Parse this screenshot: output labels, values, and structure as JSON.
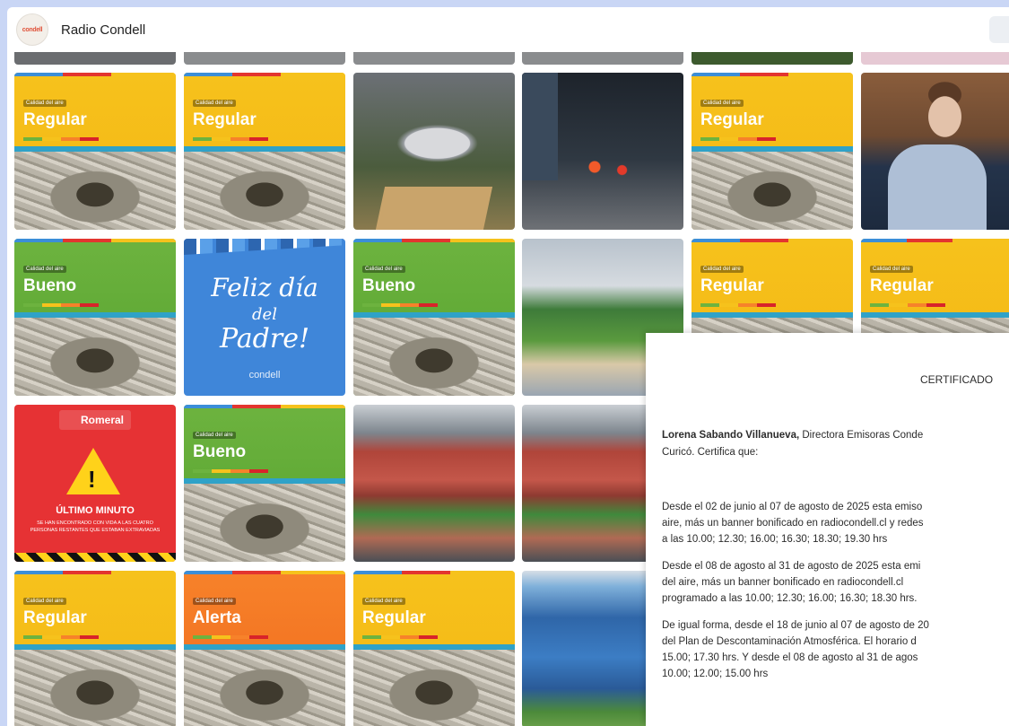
{
  "header": {
    "logo_text": "condell",
    "title": "Radio Condell"
  },
  "gallery": {
    "air_quality_label": "Calidad del aire",
    "levels": {
      "regular": "Regular",
      "bueno": "Bueno",
      "alerta": "Alerta"
    },
    "father_day": {
      "line1": "Feliz día",
      "line2": "del",
      "line3": "Padre!",
      "brand": "condell"
    },
    "alert_post": {
      "brand": "Romeral",
      "title": "ÚLTIMO MINUTO",
      "text": "SE HAN ENCONTRADO CON VIDA A LAS CUATRO PERSONAS RESTANTES QUE ESTABAN EXTRAVIADAS"
    }
  },
  "certificate": {
    "title": "CERTIFICADO",
    "intro_name": "Lorena Sabando Villanueva,",
    "intro_rest": " Directora Emisoras Conde",
    "intro_line2": "Curicó. Certifica que:",
    "para1": [
      "Desde el 02 de junio al 07 de agosto de 2025 esta emiso",
      "aire, más un banner bonificado en radiocondell.cl y redes",
      "a las 10.00; 12.30; 16.00; 16.30; 18.30; 19.30 hrs"
    ],
    "para2": [
      "Desde el 08 de agosto al 31 de agosto de 2025 esta emi",
      "del aire, más un banner bonificado en radiocondell.cl",
      "programado a las 10.00; 12.30; 16.00; 16.30; 18.30 hrs."
    ],
    "para3": [
      "De igual forma, desde el 18 de junio al 07 de agosto de 20",
      "del Plan de Descontaminación Atmosférica. El horario d",
      "15.00; 17.30 hrs. Y desde el 08 de agosto al 31 de agos",
      "10.00; 12.00; 15.00 hrs"
    ]
  }
}
